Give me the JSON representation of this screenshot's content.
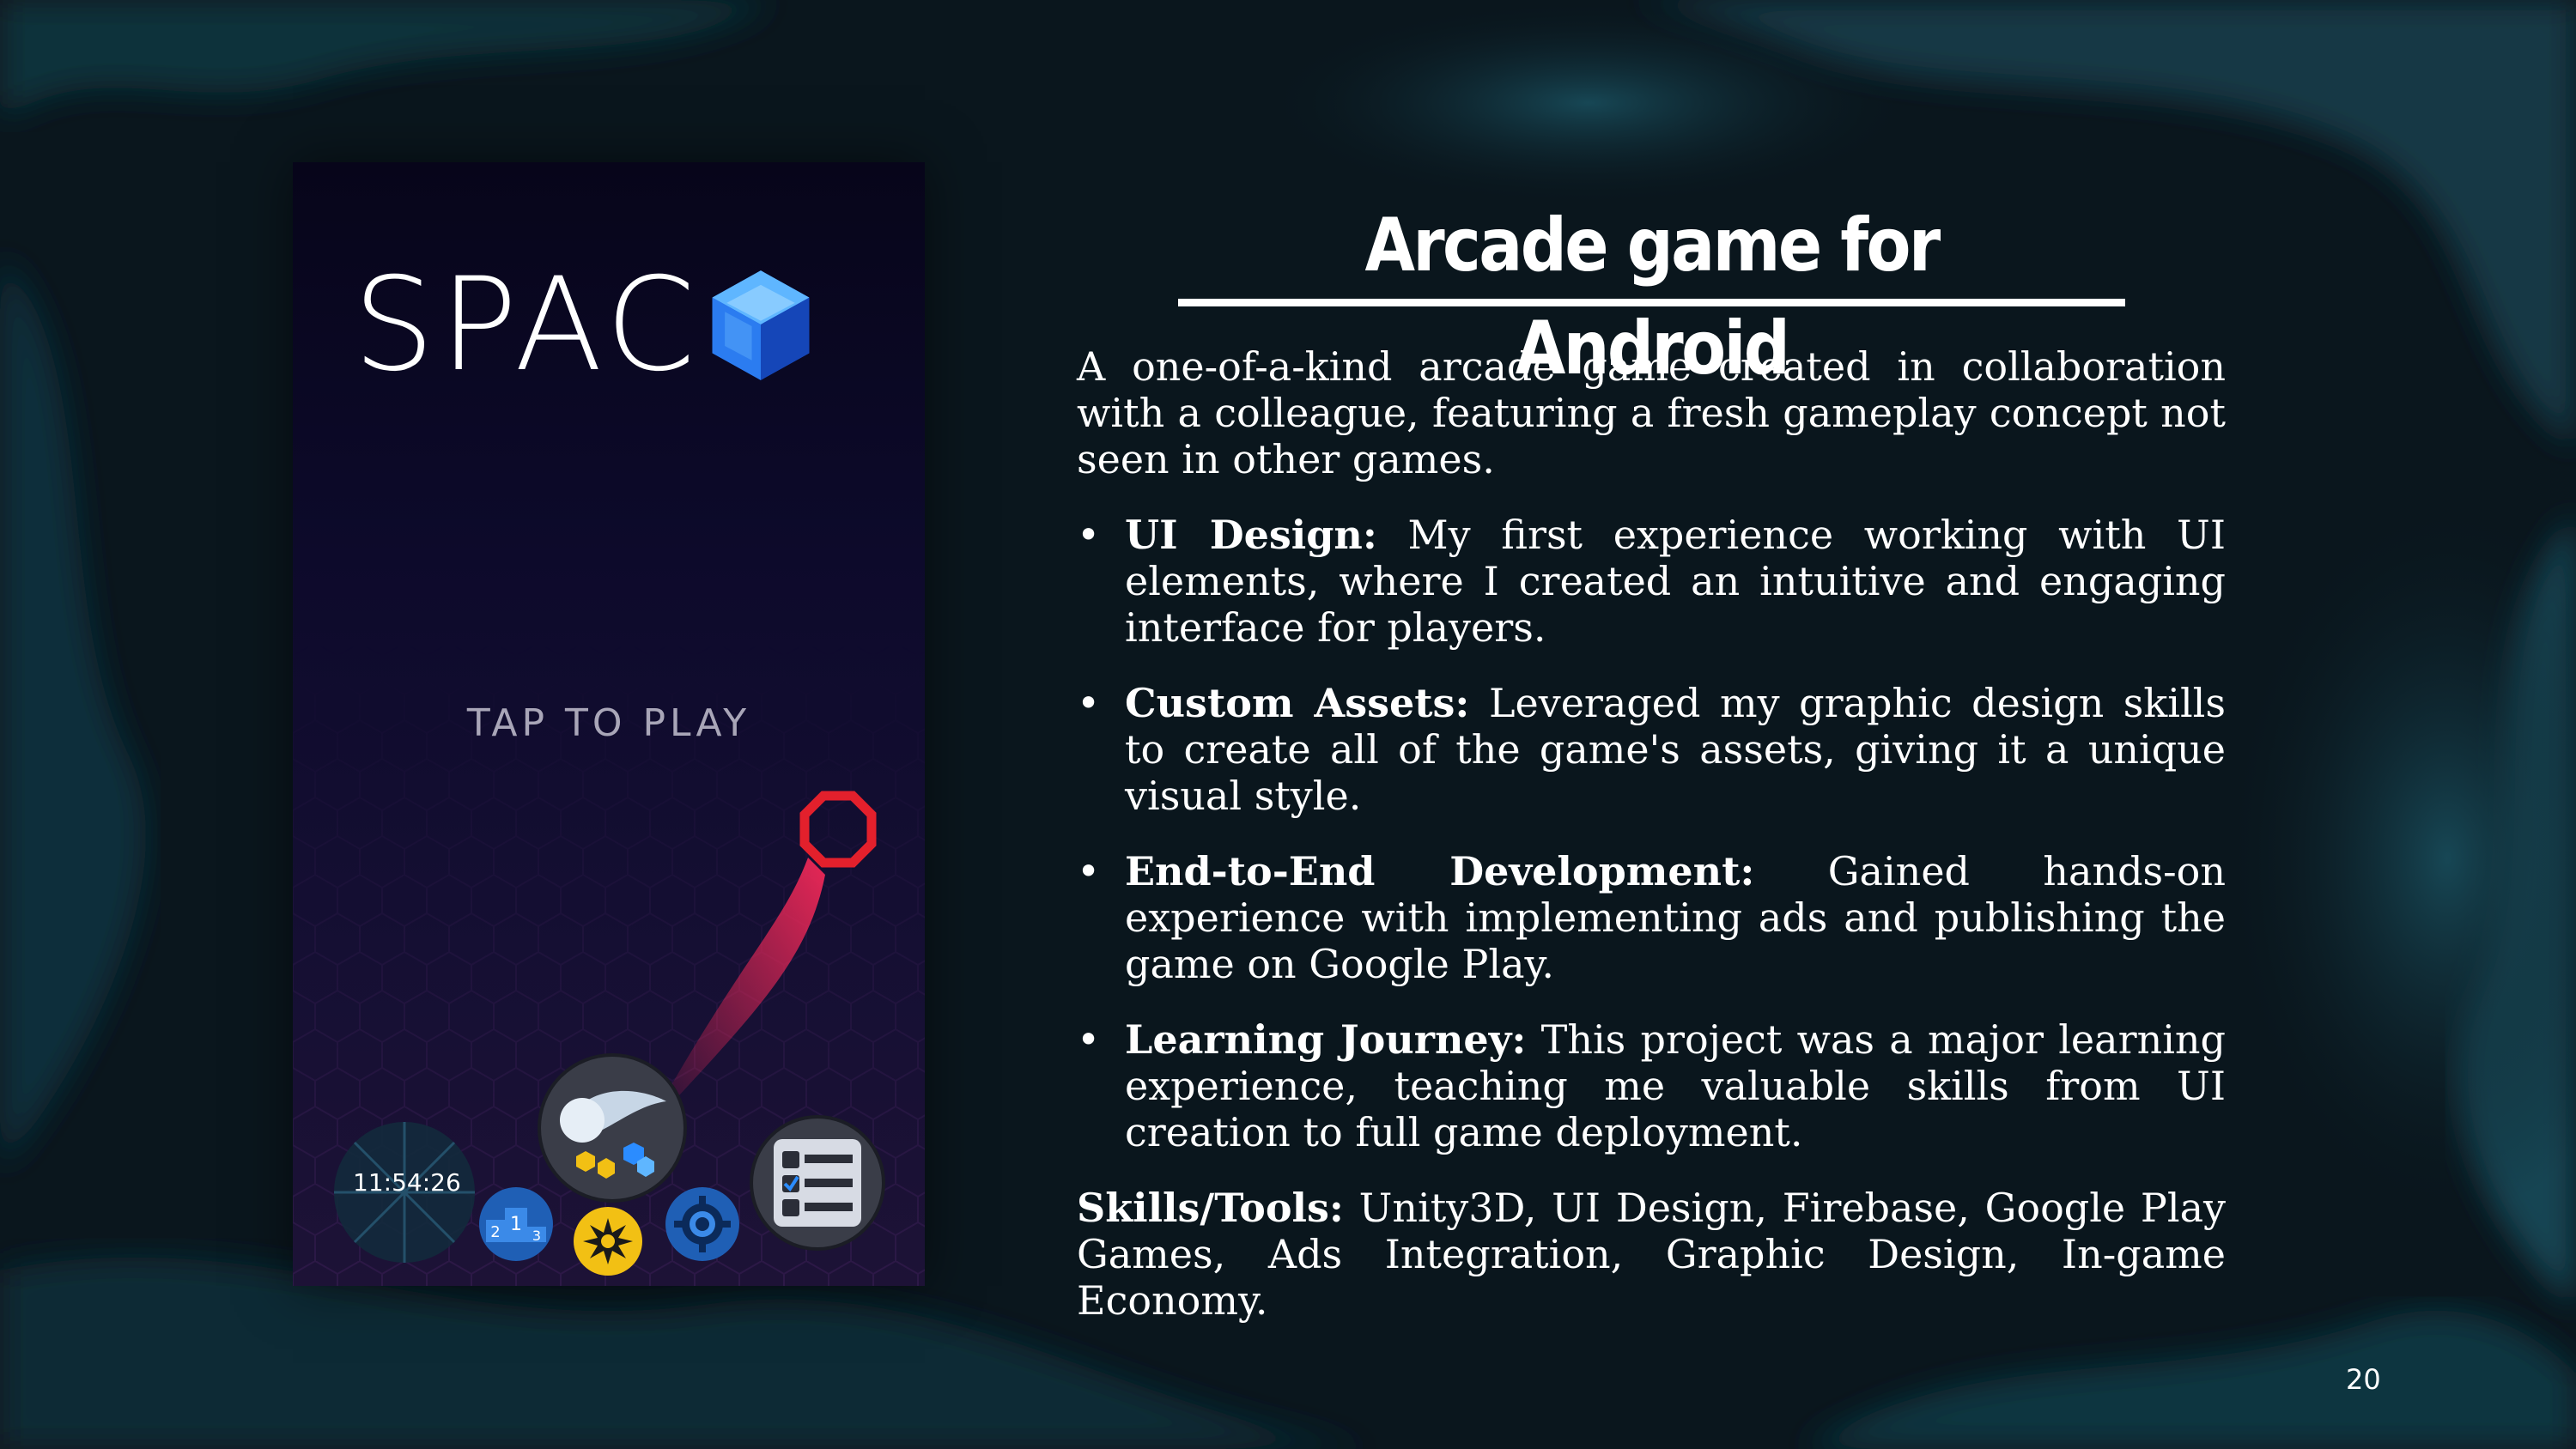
{
  "slide": {
    "title": "Arcade game for Android",
    "intro": "A one-of-a-kind arcade game created in collaboration with a colleague, featuring a fresh gameplay concept not seen in other games.",
    "bullets": [
      {
        "label": "UI Design:",
        "text": " My first experience working with UI elements, where I created an intuitive and engaging interface for players."
      },
      {
        "label": "Custom Assets:",
        "text": " Leveraged my graphic design skills to create all of the game's assets, giving it a unique visual style."
      },
      {
        "label": "End-to-End Development:",
        "text": " Gained hands-on experience with implementing ads and publishing the game on Google Play."
      },
      {
        "label": "Learning Journey:",
        "text": " This project was a major learning experience, teaching me valuable skills from UI creation to full game deployment."
      }
    ],
    "skills": {
      "label": "Skills/Tools:",
      "text": " Unity3D, UI Design, Firebase, Google Play Games, Ads Integration, Graphic Design, In-game Economy."
    },
    "page_number": "20"
  },
  "game": {
    "logo_text": "SPAC",
    "logo_icon": "blue-cube-gem-icon",
    "tap_to_play": "TAP TO PLAY",
    "timer": "11:54:26",
    "buttons": [
      "ship-skins-icon",
      "leaderboard-podium-icon",
      "burst-icon",
      "settings-gear-icon",
      "menu-list-icon"
    ]
  },
  "colors": {
    "background": "#0b1a22",
    "phone_background": "#0d0a2b",
    "accent_red": "#e3202c",
    "gem_blue": "#2b8cff"
  }
}
